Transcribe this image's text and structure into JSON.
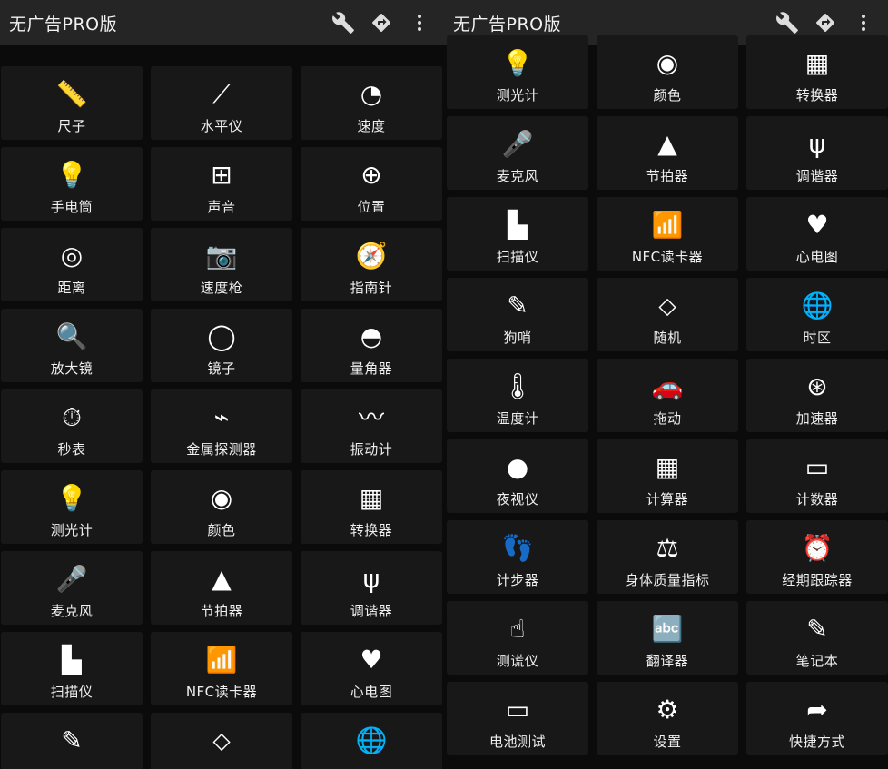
{
  "left_screen": {
    "title": "无广告PRO版",
    "toolbar": [
      {
        "name": "wrench-icon",
        "glyph": "🔧"
      },
      {
        "name": "directions-icon",
        "glyph": "⬥"
      },
      {
        "name": "more-vert-icon",
        "glyph": "⋮"
      }
    ],
    "tiles": [
      {
        "label": "尺子",
        "icon": "ruler-icon",
        "glyph": "📏"
      },
      {
        "label": "水平仪",
        "icon": "level-icon",
        "glyph": "⟋"
      },
      {
        "label": "速度",
        "icon": "speedometer-icon",
        "glyph": "◔"
      },
      {
        "label": "手电筒",
        "icon": "flashlight-icon",
        "glyph": "💡"
      },
      {
        "label": "声音",
        "icon": "sound-meter-icon",
        "glyph": "⊞"
      },
      {
        "label": "位置",
        "icon": "location-icon",
        "glyph": "⊕"
      },
      {
        "label": "距离",
        "icon": "tape-measure-icon",
        "glyph": "◎"
      },
      {
        "label": "速度枪",
        "icon": "speed-gun-icon",
        "glyph": "📷"
      },
      {
        "label": "指南针",
        "icon": "compass-icon",
        "glyph": "🧭"
      },
      {
        "label": "放大镜",
        "icon": "magnifier-icon",
        "glyph": "🔍"
      },
      {
        "label": "镜子",
        "icon": "mirror-icon",
        "glyph": "◯"
      },
      {
        "label": "量角器",
        "icon": "protractor-icon",
        "glyph": "◓"
      },
      {
        "label": "秒表",
        "icon": "stopwatch-icon",
        "glyph": "⏱"
      },
      {
        "label": "金属探测器",
        "icon": "metal-detector-icon",
        "glyph": "⌁"
      },
      {
        "label": "振动计",
        "icon": "vibration-meter-icon",
        "glyph": "〰"
      },
      {
        "label": "测光计",
        "icon": "light-meter-icon",
        "glyph": "💡"
      },
      {
        "label": "颜色",
        "icon": "color-picker-icon",
        "glyph": "◉"
      },
      {
        "label": "转换器",
        "icon": "converter-icon",
        "glyph": "▦"
      },
      {
        "label": "麦克风",
        "icon": "microphone-icon",
        "glyph": "🎤"
      },
      {
        "label": "节拍器",
        "icon": "metronome-icon",
        "glyph": "▲"
      },
      {
        "label": "调谐器",
        "icon": "tuning-fork-icon",
        "glyph": "ψ"
      },
      {
        "label": "扫描仪",
        "icon": "barcode-scanner-icon",
        "glyph": "▙"
      },
      {
        "label": "NFC读卡器",
        "icon": "nfc-icon",
        "glyph": "📶"
      },
      {
        "label": "心电图",
        "icon": "heart-rate-icon",
        "glyph": "♥"
      },
      {
        "label": "",
        "icon": "dog-whistle-icon",
        "glyph": "✎"
      },
      {
        "label": "",
        "icon": "dice-icon",
        "glyph": "⬦"
      },
      {
        "label": "",
        "icon": "globe-icon",
        "glyph": "🌐"
      }
    ]
  },
  "right_screen": {
    "title": "无广告PRO版",
    "toolbar": [
      {
        "name": "wrench-icon",
        "glyph": "🔧"
      },
      {
        "name": "directions-icon",
        "glyph": "⬥"
      },
      {
        "name": "more-vert-icon",
        "glyph": "⋮"
      }
    ],
    "tiles": [
      {
        "label": "测光计",
        "icon": "light-meter-icon",
        "glyph": "💡"
      },
      {
        "label": "颜色",
        "icon": "color-picker-icon",
        "glyph": "◉"
      },
      {
        "label": "转换器",
        "icon": "converter-icon",
        "glyph": "▦"
      },
      {
        "label": "麦克风",
        "icon": "microphone-icon",
        "glyph": "🎤"
      },
      {
        "label": "节拍器",
        "icon": "metronome-icon",
        "glyph": "▲"
      },
      {
        "label": "调谐器",
        "icon": "tuning-fork-icon",
        "glyph": "ψ"
      },
      {
        "label": "扫描仪",
        "icon": "barcode-scanner-icon",
        "glyph": "▙"
      },
      {
        "label": "NFC读卡器",
        "icon": "nfc-icon",
        "glyph": "📶"
      },
      {
        "label": "心电图",
        "icon": "heart-rate-icon",
        "glyph": "♥"
      },
      {
        "label": "狗哨",
        "icon": "dog-whistle-icon",
        "glyph": "✎"
      },
      {
        "label": "随机",
        "icon": "dice-icon",
        "glyph": "⬦"
      },
      {
        "label": "时区",
        "icon": "globe-icon",
        "glyph": "🌐"
      },
      {
        "label": "温度计",
        "icon": "thermometer-icon",
        "glyph": "🌡"
      },
      {
        "label": "拖动",
        "icon": "car-icon",
        "glyph": "🚗"
      },
      {
        "label": "加速器",
        "icon": "accelerometer-icon",
        "glyph": "⊛"
      },
      {
        "label": "夜视仪",
        "icon": "night-vision-icon",
        "glyph": "●"
      },
      {
        "label": "计算器",
        "icon": "calculator-icon",
        "glyph": "▦"
      },
      {
        "label": "计数器",
        "icon": "counter-icon",
        "glyph": "▭"
      },
      {
        "label": "计步器",
        "icon": "footsteps-icon",
        "glyph": "👣"
      },
      {
        "label": "身体质量指标",
        "icon": "bmi-scale-icon",
        "glyph": "⚖"
      },
      {
        "label": "经期跟踪器",
        "icon": "alarm-clock-icon",
        "glyph": "⏰"
      },
      {
        "label": "测谎仪",
        "icon": "finger-touch-icon",
        "glyph": "☝"
      },
      {
        "label": "翻译器",
        "icon": "translator-icon",
        "glyph": "🔤"
      },
      {
        "label": "笔记本",
        "icon": "notepad-icon",
        "glyph": "✎"
      },
      {
        "label": "电池测试",
        "icon": "battery-icon",
        "glyph": "▭"
      },
      {
        "label": "设置",
        "icon": "settings-gear-icon",
        "glyph": "⚙"
      },
      {
        "label": "快捷方式",
        "icon": "share-shortcut-icon",
        "glyph": "➦"
      }
    ]
  }
}
